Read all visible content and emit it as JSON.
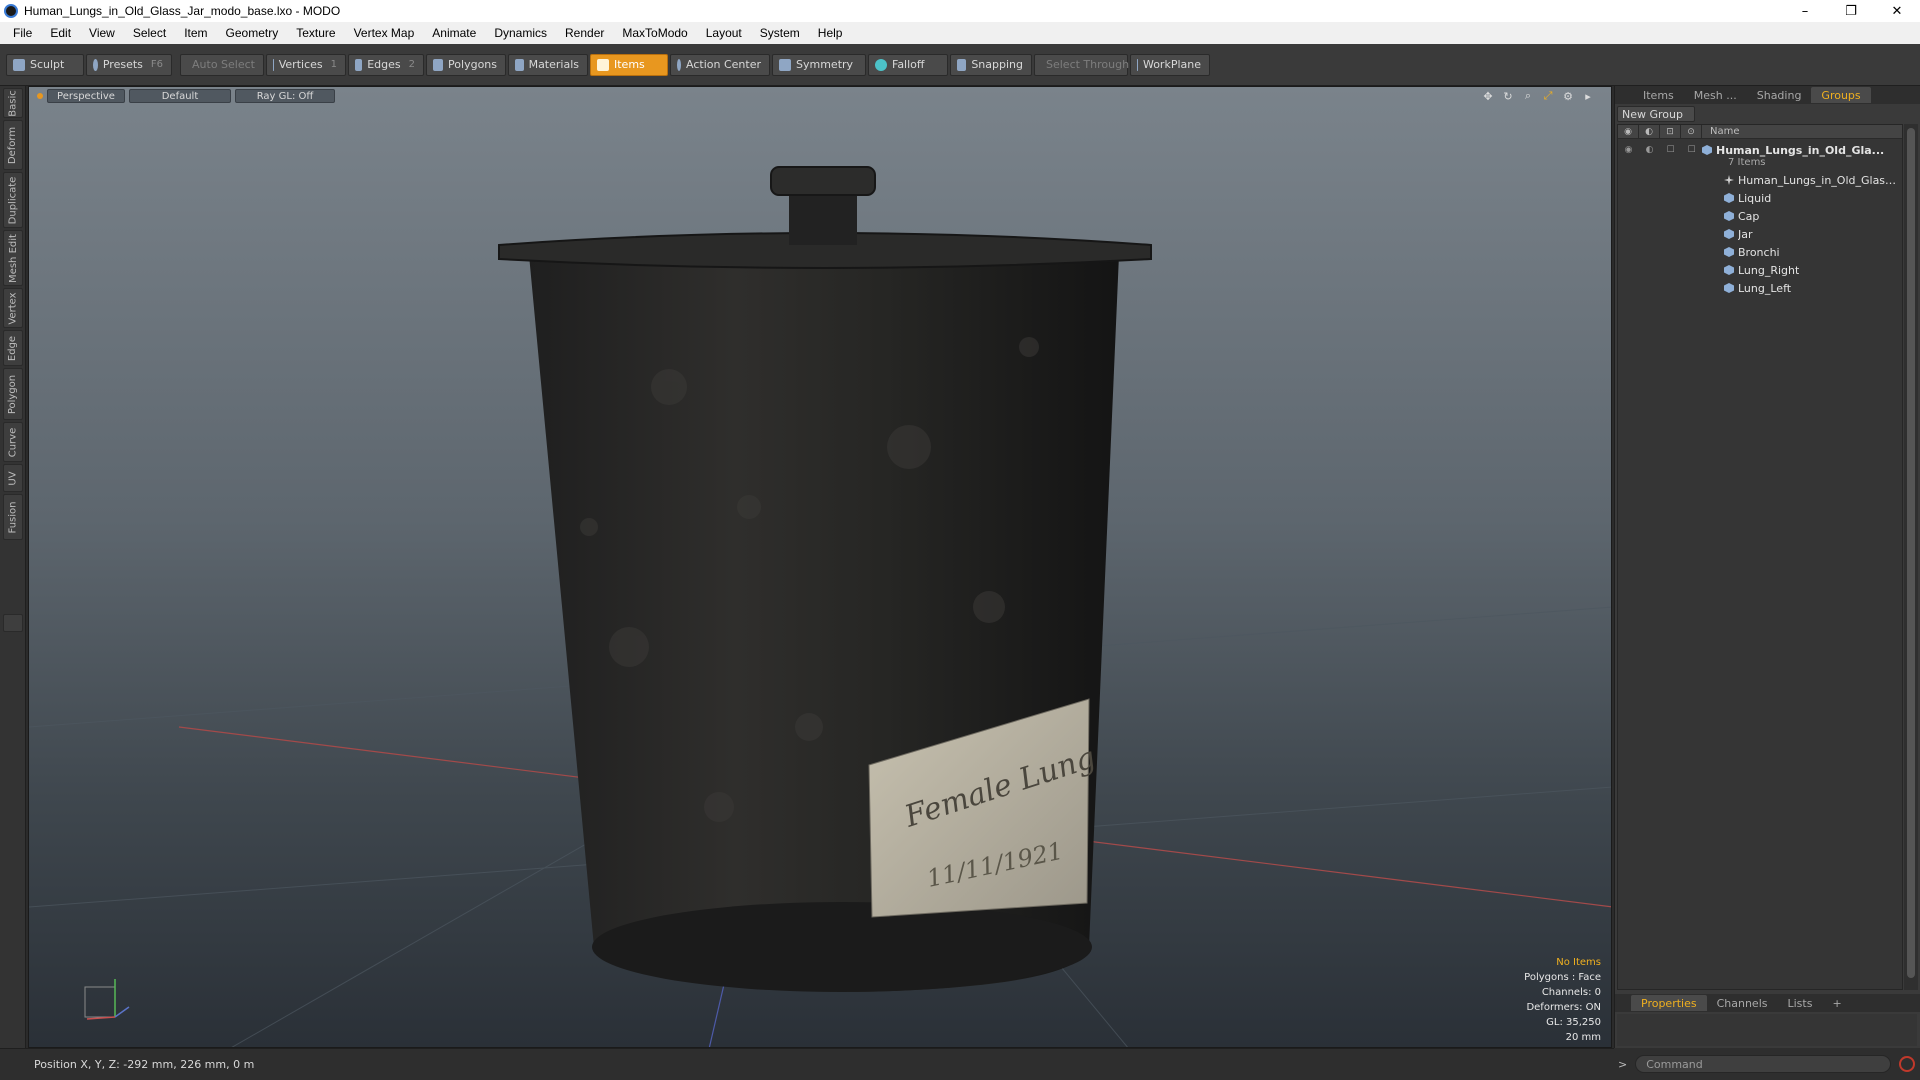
{
  "window": {
    "title": "Human_Lungs_in_Old_Glass_Jar_modo_base.lxo - MODO",
    "minimize": "–",
    "restore": "❐",
    "close": "✕"
  },
  "menu": [
    "File",
    "Edit",
    "View",
    "Select",
    "Item",
    "Geometry",
    "Texture",
    "Vertex Map",
    "Animate",
    "Dynamics",
    "Render",
    "MaxToModo",
    "Layout",
    "System",
    "Help"
  ],
  "toolbar": {
    "sculpt": "Sculpt",
    "presets": "Presets",
    "presets_key": "F6",
    "auto_select": "Auto Select",
    "vertices": "Vertices",
    "vertices_key": "1",
    "edges": "Edges",
    "edges_key": "2",
    "polygons": "Polygons",
    "materials": "Materials",
    "items": "Items",
    "action_center": "Action Center",
    "symmetry": "Symmetry",
    "falloff": "Falloff",
    "snapping": "Snapping",
    "select_through": "Select Through",
    "workplane": "WorkPlane"
  },
  "left_tabs": [
    "Basic",
    "Deform",
    "Duplicate",
    "Mesh Edit",
    "Vertex",
    "Edge",
    "Polygon",
    "Curve",
    "UV",
    "Fusion"
  ],
  "viewport": {
    "view": "Perspective",
    "shading": "Default",
    "raygl": "Ray GL: Off",
    "label_line1": "Female Lung",
    "label_line2": "11/11/1921",
    "info": {
      "items": "No Items",
      "polygons": "Polygons : Face",
      "channels": "Channels: 0",
      "deformers": "Deformers: ON",
      "gl": "GL: 35,250",
      "scale": "20 mm"
    }
  },
  "right_panel": {
    "tabs": [
      "Items",
      "Mesh ...",
      "Shading",
      "Groups"
    ],
    "active_tab": "Groups",
    "new_group": "New Group",
    "name_col": "Name",
    "root": "Human_Lungs_in_Old_Gla...",
    "root_count": "7 Items",
    "children": [
      "Human_Lungs_in_Old_Glass...",
      "Liquid",
      "Cap",
      "Jar",
      "Bronchi",
      "Lung_Right",
      "Lung_Left"
    ],
    "bottom_tabs": [
      "Properties",
      "Channels",
      "Lists",
      "+"
    ],
    "command_placeholder": "Command",
    "command_prompt": ">"
  },
  "status": {
    "position": "Position X, Y, Z:  -292 mm, 226 mm, 0 m"
  },
  "colors": {
    "accent": "#e8971f",
    "viewport_top": "#7a838b",
    "viewport_bottom": "#2a3037"
  }
}
